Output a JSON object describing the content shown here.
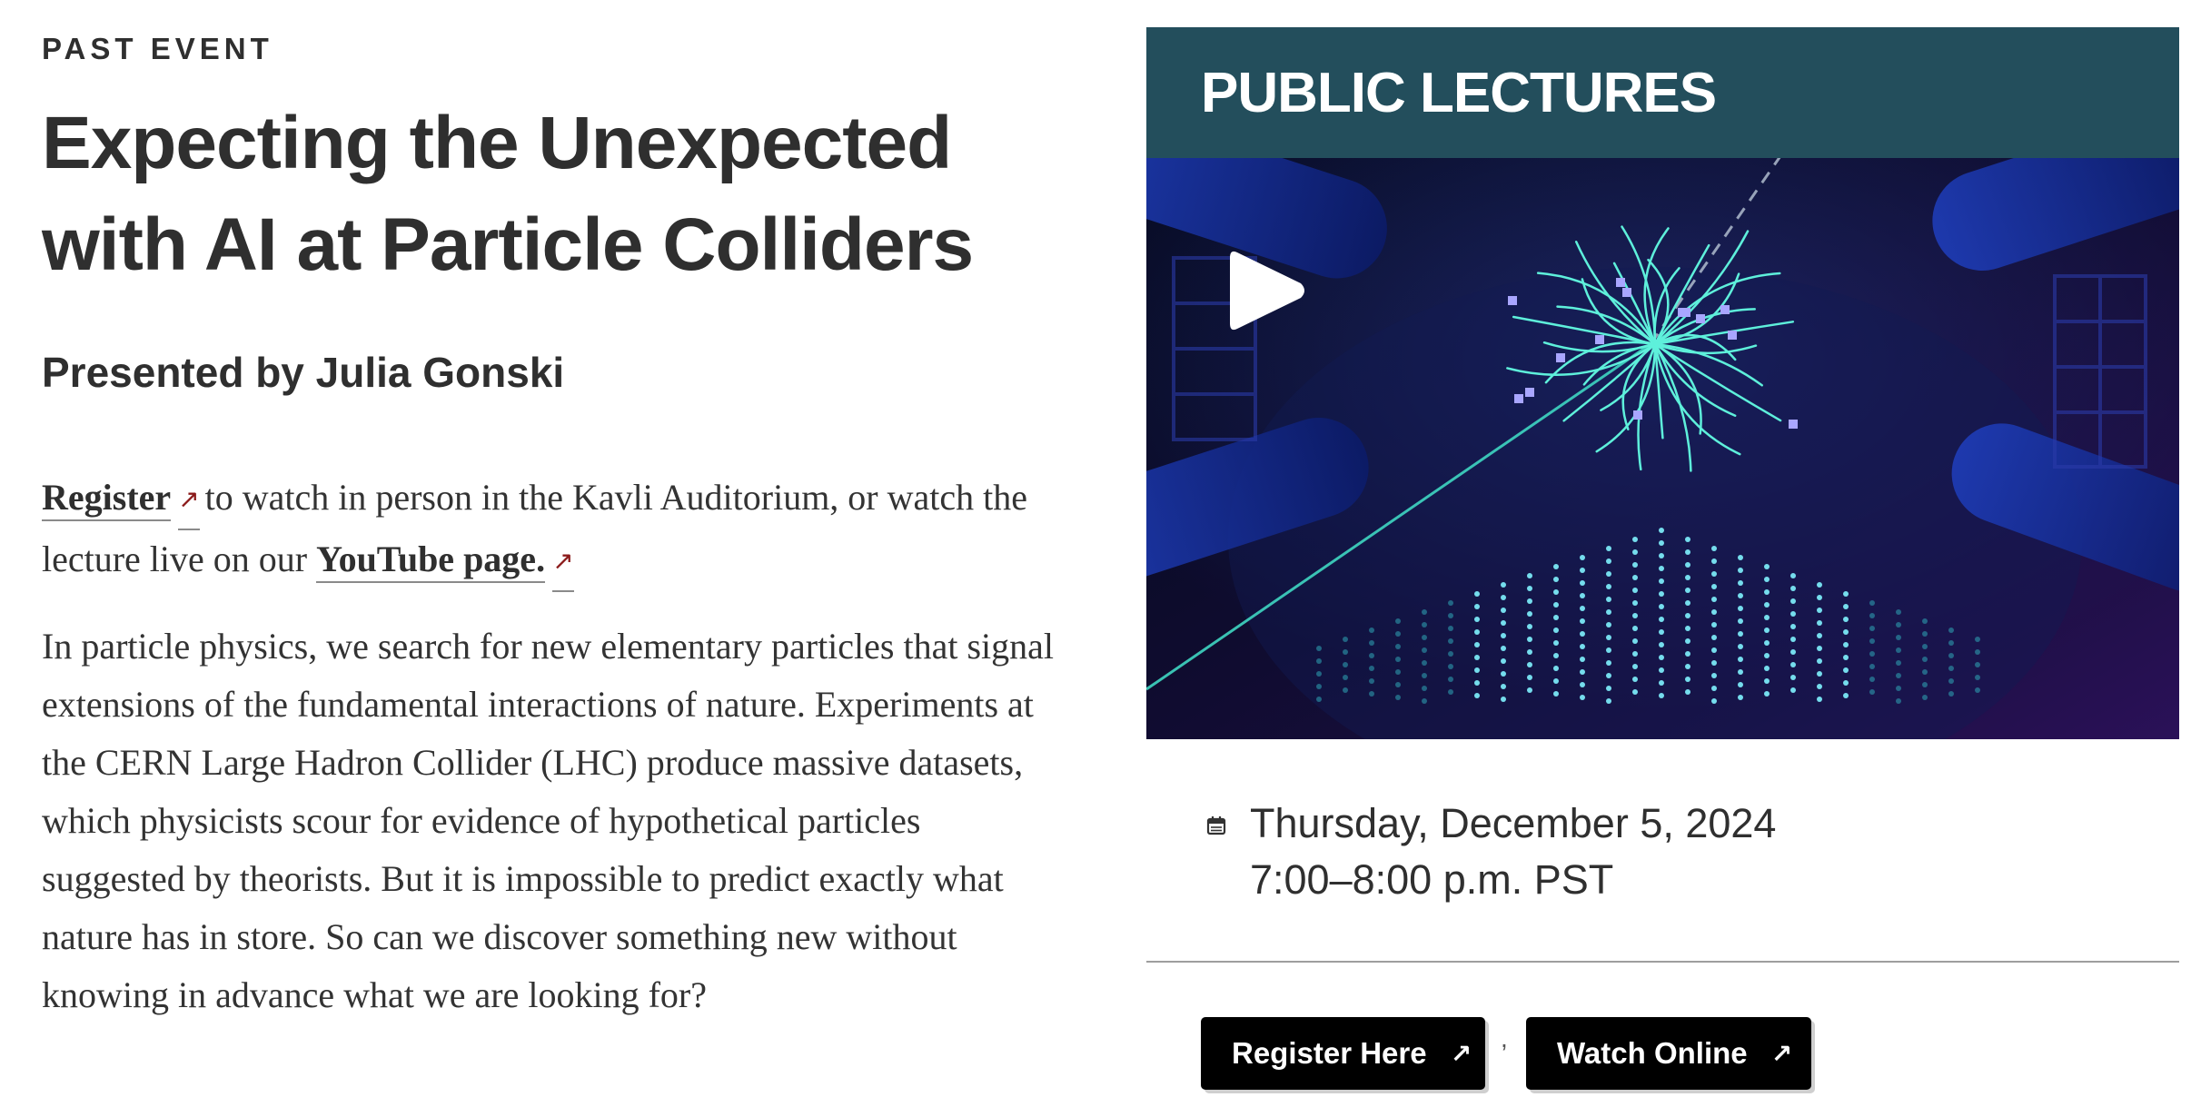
{
  "event": {
    "status": "PAST EVENT",
    "title_line1": "Expecting the Unexpected",
    "title_line2": "with AI at Particle Colliders",
    "presenter": "Presented by Julia Gonski"
  },
  "register_paragraph": {
    "register_link": "Register",
    "text1": "to watch in person in the Kavli Auditorium, or watch the lecture live on our",
    "youtube_link": "YouTube page."
  },
  "description": "In particle physics, we search for new elementary particles that signal extensions of the fundamental interactions of nature. Experiments at the CERN Large Hadron Collider (LHC) produce massive datasets, which physicists scour for evidence of hypothetical particles suggested by theorists.  But it is impossible to predict exactly what nature has in store. So can we discover something new without knowing in advance what we are looking for?",
  "sidebar": {
    "banner_title": "PUBLIC LECTURES",
    "date": "Thursday, December 5, 2024",
    "time": "7:00–8:00 p.m. PST",
    "separator": ",",
    "buttons": {
      "register": "Register Here",
      "watch": "Watch Online"
    }
  },
  "icons": {
    "external_link": "↗",
    "calendar": "calendar-icon",
    "play": "play-icon"
  },
  "colors": {
    "banner_bg": "#234e5c",
    "link_arrow": "#8b1a1a",
    "button_bg": "#000000"
  }
}
